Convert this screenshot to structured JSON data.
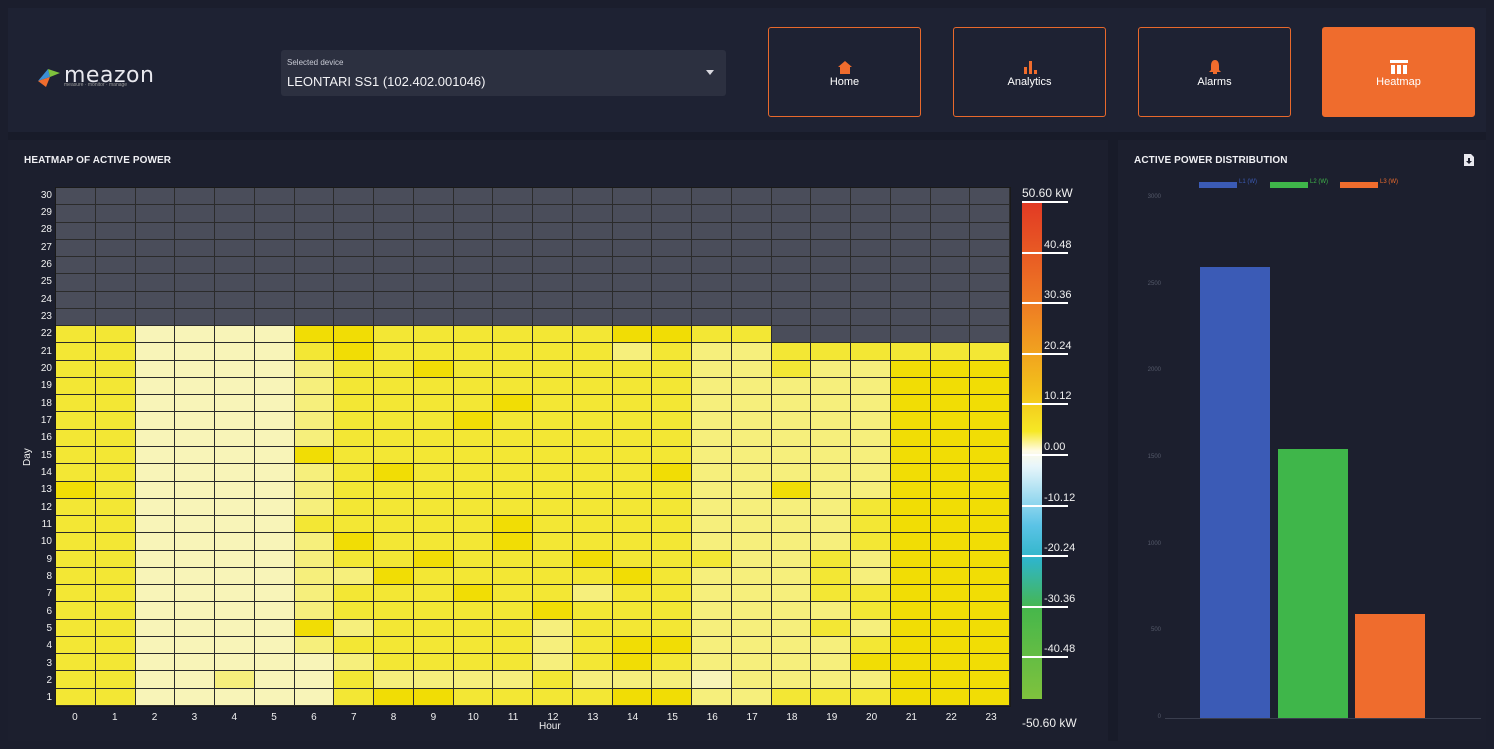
{
  "brand": {
    "name": "meazon",
    "tagline": "measure · monitor · manage"
  },
  "device_selector": {
    "label": "Selected device",
    "value": "LEONTARI SS1  (102.402.001046)"
  },
  "nav": [
    {
      "label": "Home",
      "icon": "home-icon",
      "active": false
    },
    {
      "label": "Analytics",
      "icon": "bar-chart-icon",
      "active": false
    },
    {
      "label": "Alarms",
      "icon": "bell-icon",
      "active": false
    },
    {
      "label": "Heatmap",
      "icon": "table-icon",
      "active": true
    }
  ],
  "heatmap": {
    "title": "HEATMAP OF ACTIVE POWER",
    "xlabel": "Hour",
    "ylabel": "Day",
    "colorbar": {
      "max_label": "50.60 kW",
      "min_label": "-50.60 kW",
      "ticks": [
        "40.48",
        "30.36",
        "20.24",
        "10.12",
        "0.00",
        "-10.12",
        "-20.24",
        "-30.36",
        "-40.48"
      ]
    },
    "no_data_color": "#4a4d5a",
    "scale_colors": [
      "#fdfbe3",
      "#f8f4b8",
      "#f6ef7c",
      "#f3e734",
      "#f1dd05"
    ]
  },
  "distribution": {
    "title": "ACTIVE POWER DISTRIBUTION",
    "export_icon": "file-download-icon",
    "legend": [
      {
        "name": "L1 (W)",
        "color": "#3b5bb6"
      },
      {
        "name": "L2 (W)",
        "color": "#3fb64a"
      },
      {
        "name": "L3 (W)",
        "color": "#ef6c2d"
      }
    ],
    "y_ticks": [
      "0",
      "500",
      "1000",
      "1500",
      "2000",
      "2500",
      "3000"
    ]
  },
  "chart_data": {
    "type": "heatmap",
    "title": "HEATMAP OF ACTIVE POWER",
    "xlabel": "Hour",
    "ylabel": "Day",
    "x": [
      0,
      1,
      2,
      3,
      4,
      5,
      6,
      7,
      8,
      9,
      10,
      11,
      12,
      13,
      14,
      15,
      16,
      17,
      18,
      19,
      20,
      21,
      22,
      23
    ],
    "y": [
      1,
      2,
      3,
      4,
      5,
      6,
      7,
      8,
      9,
      10,
      11,
      12,
      13,
      14,
      15,
      16,
      17,
      18,
      19,
      20,
      21,
      22,
      23,
      24,
      25,
      26,
      27,
      28,
      29,
      30
    ],
    "value_range": [
      -50.6,
      50.6
    ],
    "units": "kW",
    "z_levels": [
      [
        3,
        3,
        1,
        1,
        1,
        1,
        1,
        3,
        4,
        4,
        3,
        3,
        3,
        3,
        4,
        4,
        2,
        2,
        3,
        3,
        3,
        4,
        4,
        4
      ],
      [
        3,
        3,
        1,
        1,
        2,
        1,
        1,
        3,
        2,
        2,
        2,
        2,
        3,
        2,
        2,
        2,
        1,
        2,
        2,
        2,
        2,
        4,
        4,
        4
      ],
      [
        3,
        3,
        1,
        1,
        1,
        1,
        1,
        2,
        3,
        3,
        3,
        3,
        2,
        3,
        4,
        3,
        2,
        2,
        2,
        2,
        4,
        4,
        4,
        4
      ],
      [
        3,
        3,
        1,
        1,
        1,
        1,
        2,
        3,
        3,
        3,
        3,
        3,
        2,
        3,
        4,
        4,
        2,
        2,
        2,
        2,
        3,
        4,
        4,
        4
      ],
      [
        3,
        3,
        1,
        1,
        1,
        1,
        4,
        2,
        3,
        3,
        3,
        3,
        2,
        3,
        3,
        3,
        2,
        2,
        2,
        3,
        2,
        4,
        4,
        4
      ],
      [
        3,
        3,
        1,
        1,
        1,
        1,
        2,
        3,
        3,
        3,
        3,
        3,
        4,
        3,
        3,
        3,
        2,
        2,
        2,
        2,
        3,
        4,
        4,
        4
      ],
      [
        3,
        3,
        1,
        1,
        1,
        1,
        2,
        3,
        3,
        3,
        4,
        3,
        3,
        2,
        3,
        3,
        2,
        2,
        2,
        3,
        3,
        4,
        4,
        4
      ],
      [
        3,
        3,
        1,
        1,
        1,
        1,
        2,
        2,
        4,
        3,
        3,
        3,
        3,
        3,
        4,
        3,
        2,
        2,
        2,
        3,
        2,
        4,
        4,
        4
      ],
      [
        3,
        3,
        1,
        1,
        1,
        1,
        2,
        3,
        3,
        4,
        3,
        3,
        3,
        4,
        3,
        3,
        3,
        2,
        2,
        3,
        2,
        4,
        4,
        4
      ],
      [
        3,
        3,
        1,
        1,
        1,
        1,
        2,
        4,
        3,
        3,
        3,
        4,
        3,
        3,
        3,
        3,
        2,
        2,
        2,
        2,
        3,
        4,
        4,
        4
      ],
      [
        3,
        3,
        1,
        1,
        1,
        1,
        3,
        3,
        3,
        3,
        3,
        4,
        3,
        3,
        3,
        3,
        2,
        2,
        2,
        2,
        3,
        4,
        4,
        4
      ],
      [
        3,
        3,
        1,
        1,
        1,
        1,
        2,
        3,
        3,
        3,
        3,
        3,
        3,
        3,
        3,
        3,
        2,
        2,
        2,
        2,
        3,
        4,
        4,
        4
      ],
      [
        4,
        3,
        1,
        1,
        1,
        1,
        2,
        3,
        3,
        3,
        3,
        3,
        3,
        3,
        3,
        3,
        2,
        2,
        4,
        2,
        2,
        4,
        4,
        4
      ],
      [
        3,
        3,
        1,
        1,
        1,
        1,
        2,
        3,
        4,
        3,
        3,
        3,
        3,
        3,
        3,
        4,
        2,
        2,
        2,
        2,
        2,
        4,
        4,
        4
      ],
      [
        3,
        3,
        1,
        1,
        1,
        1,
        4,
        3,
        3,
        3,
        3,
        3,
        3,
        3,
        3,
        3,
        2,
        2,
        2,
        2,
        2,
        4,
        4,
        4
      ],
      [
        3,
        3,
        1,
        1,
        1,
        1,
        2,
        3,
        3,
        3,
        3,
        3,
        3,
        3,
        3,
        3,
        2,
        2,
        2,
        2,
        2,
        4,
        4,
        4
      ],
      [
        3,
        3,
        1,
        1,
        1,
        1,
        2,
        3,
        3,
        3,
        4,
        3,
        3,
        3,
        3,
        3,
        2,
        2,
        2,
        2,
        2,
        4,
        4,
        4
      ],
      [
        3,
        3,
        1,
        1,
        1,
        1,
        2,
        3,
        3,
        3,
        3,
        4,
        3,
        3,
        3,
        3,
        2,
        2,
        2,
        2,
        2,
        4,
        4,
        4
      ],
      [
        3,
        3,
        1,
        1,
        1,
        1,
        2,
        3,
        3,
        3,
        3,
        3,
        3,
        3,
        3,
        3,
        2,
        2,
        2,
        2,
        2,
        4,
        4,
        4
      ],
      [
        3,
        3,
        1,
        1,
        1,
        1,
        2,
        3,
        3,
        4,
        3,
        3,
        3,
        3,
        3,
        3,
        2,
        2,
        3,
        2,
        2,
        4,
        4,
        4
      ],
      [
        3,
        3,
        1,
        1,
        1,
        1,
        3,
        4,
        3,
        3,
        3,
        3,
        3,
        3,
        2,
        3,
        2,
        2,
        3,
        3,
        3,
        3,
        3,
        3
      ],
      [
        3,
        3,
        1,
        1,
        1,
        1,
        4,
        4,
        3,
        3,
        3,
        3,
        3,
        3,
        4,
        4,
        3,
        3,
        null,
        null,
        null,
        null,
        null,
        null
      ],
      [
        null,
        null,
        null,
        null,
        null,
        null,
        null,
        null,
        null,
        null,
        null,
        null,
        null,
        null,
        null,
        null,
        null,
        null,
        null,
        null,
        null,
        null,
        null,
        null
      ],
      [
        null,
        null,
        null,
        null,
        null,
        null,
        null,
        null,
        null,
        null,
        null,
        null,
        null,
        null,
        null,
        null,
        null,
        null,
        null,
        null,
        null,
        null,
        null,
        null
      ],
      [
        null,
        null,
        null,
        null,
        null,
        null,
        null,
        null,
        null,
        null,
        null,
        null,
        null,
        null,
        null,
        null,
        null,
        null,
        null,
        null,
        null,
        null,
        null,
        null
      ],
      [
        null,
        null,
        null,
        null,
        null,
        null,
        null,
        null,
        null,
        null,
        null,
        null,
        null,
        null,
        null,
        null,
        null,
        null,
        null,
        null,
        null,
        null,
        null,
        null
      ],
      [
        null,
        null,
        null,
        null,
        null,
        null,
        null,
        null,
        null,
        null,
        null,
        null,
        null,
        null,
        null,
        null,
        null,
        null,
        null,
        null,
        null,
        null,
        null,
        null
      ],
      [
        null,
        null,
        null,
        null,
        null,
        null,
        null,
        null,
        null,
        null,
        null,
        null,
        null,
        null,
        null,
        null,
        null,
        null,
        null,
        null,
        null,
        null,
        null,
        null
      ],
      [
        null,
        null,
        null,
        null,
        null,
        null,
        null,
        null,
        null,
        null,
        null,
        null,
        null,
        null,
        null,
        null,
        null,
        null,
        null,
        null,
        null,
        null,
        null,
        null
      ],
      [
        null,
        null,
        null,
        null,
        null,
        null,
        null,
        null,
        null,
        null,
        null,
        null,
        null,
        null,
        null,
        null,
        null,
        null,
        null,
        null,
        null,
        null,
        null,
        null
      ]
    ],
    "distribution": {
      "type": "bar",
      "categories": [
        "L1 (W)",
        "L2 (W)",
        "L3 (W)"
      ],
      "values": [
        2600,
        1550,
        600
      ],
      "ylim": [
        0,
        3000
      ]
    }
  }
}
